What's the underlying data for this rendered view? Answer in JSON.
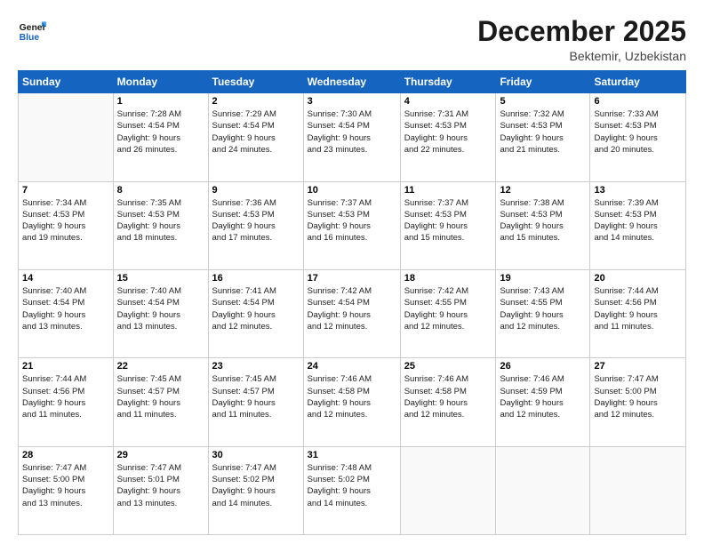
{
  "header": {
    "logo_line1": "General",
    "logo_line2": "Blue",
    "month": "December 2025",
    "location": "Bektemir, Uzbekistan"
  },
  "weekdays": [
    "Sunday",
    "Monday",
    "Tuesday",
    "Wednesday",
    "Thursday",
    "Friday",
    "Saturday"
  ],
  "weeks": [
    [
      {
        "day": "",
        "info": ""
      },
      {
        "day": "1",
        "info": "Sunrise: 7:28 AM\nSunset: 4:54 PM\nDaylight: 9 hours\nand 26 minutes."
      },
      {
        "day": "2",
        "info": "Sunrise: 7:29 AM\nSunset: 4:54 PM\nDaylight: 9 hours\nand 24 minutes."
      },
      {
        "day": "3",
        "info": "Sunrise: 7:30 AM\nSunset: 4:54 PM\nDaylight: 9 hours\nand 23 minutes."
      },
      {
        "day": "4",
        "info": "Sunrise: 7:31 AM\nSunset: 4:53 PM\nDaylight: 9 hours\nand 22 minutes."
      },
      {
        "day": "5",
        "info": "Sunrise: 7:32 AM\nSunset: 4:53 PM\nDaylight: 9 hours\nand 21 minutes."
      },
      {
        "day": "6",
        "info": "Sunrise: 7:33 AM\nSunset: 4:53 PM\nDaylight: 9 hours\nand 20 minutes."
      }
    ],
    [
      {
        "day": "7",
        "info": "Sunrise: 7:34 AM\nSunset: 4:53 PM\nDaylight: 9 hours\nand 19 minutes."
      },
      {
        "day": "8",
        "info": "Sunrise: 7:35 AM\nSunset: 4:53 PM\nDaylight: 9 hours\nand 18 minutes."
      },
      {
        "day": "9",
        "info": "Sunrise: 7:36 AM\nSunset: 4:53 PM\nDaylight: 9 hours\nand 17 minutes."
      },
      {
        "day": "10",
        "info": "Sunrise: 7:37 AM\nSunset: 4:53 PM\nDaylight: 9 hours\nand 16 minutes."
      },
      {
        "day": "11",
        "info": "Sunrise: 7:37 AM\nSunset: 4:53 PM\nDaylight: 9 hours\nand 15 minutes."
      },
      {
        "day": "12",
        "info": "Sunrise: 7:38 AM\nSunset: 4:53 PM\nDaylight: 9 hours\nand 15 minutes."
      },
      {
        "day": "13",
        "info": "Sunrise: 7:39 AM\nSunset: 4:53 PM\nDaylight: 9 hours\nand 14 minutes."
      }
    ],
    [
      {
        "day": "14",
        "info": "Sunrise: 7:40 AM\nSunset: 4:54 PM\nDaylight: 9 hours\nand 13 minutes."
      },
      {
        "day": "15",
        "info": "Sunrise: 7:40 AM\nSunset: 4:54 PM\nDaylight: 9 hours\nand 13 minutes."
      },
      {
        "day": "16",
        "info": "Sunrise: 7:41 AM\nSunset: 4:54 PM\nDaylight: 9 hours\nand 12 minutes."
      },
      {
        "day": "17",
        "info": "Sunrise: 7:42 AM\nSunset: 4:54 PM\nDaylight: 9 hours\nand 12 minutes."
      },
      {
        "day": "18",
        "info": "Sunrise: 7:42 AM\nSunset: 4:55 PM\nDaylight: 9 hours\nand 12 minutes."
      },
      {
        "day": "19",
        "info": "Sunrise: 7:43 AM\nSunset: 4:55 PM\nDaylight: 9 hours\nand 12 minutes."
      },
      {
        "day": "20",
        "info": "Sunrise: 7:44 AM\nSunset: 4:56 PM\nDaylight: 9 hours\nand 11 minutes."
      }
    ],
    [
      {
        "day": "21",
        "info": "Sunrise: 7:44 AM\nSunset: 4:56 PM\nDaylight: 9 hours\nand 11 minutes."
      },
      {
        "day": "22",
        "info": "Sunrise: 7:45 AM\nSunset: 4:57 PM\nDaylight: 9 hours\nand 11 minutes."
      },
      {
        "day": "23",
        "info": "Sunrise: 7:45 AM\nSunset: 4:57 PM\nDaylight: 9 hours\nand 11 minutes."
      },
      {
        "day": "24",
        "info": "Sunrise: 7:46 AM\nSunset: 4:58 PM\nDaylight: 9 hours\nand 12 minutes."
      },
      {
        "day": "25",
        "info": "Sunrise: 7:46 AM\nSunset: 4:58 PM\nDaylight: 9 hours\nand 12 minutes."
      },
      {
        "day": "26",
        "info": "Sunrise: 7:46 AM\nSunset: 4:59 PM\nDaylight: 9 hours\nand 12 minutes."
      },
      {
        "day": "27",
        "info": "Sunrise: 7:47 AM\nSunset: 5:00 PM\nDaylight: 9 hours\nand 12 minutes."
      }
    ],
    [
      {
        "day": "28",
        "info": "Sunrise: 7:47 AM\nSunset: 5:00 PM\nDaylight: 9 hours\nand 13 minutes."
      },
      {
        "day": "29",
        "info": "Sunrise: 7:47 AM\nSunset: 5:01 PM\nDaylight: 9 hours\nand 13 minutes."
      },
      {
        "day": "30",
        "info": "Sunrise: 7:47 AM\nSunset: 5:02 PM\nDaylight: 9 hours\nand 14 minutes."
      },
      {
        "day": "31",
        "info": "Sunrise: 7:48 AM\nSunset: 5:02 PM\nDaylight: 9 hours\nand 14 minutes."
      },
      {
        "day": "",
        "info": ""
      },
      {
        "day": "",
        "info": ""
      },
      {
        "day": "",
        "info": ""
      }
    ]
  ]
}
